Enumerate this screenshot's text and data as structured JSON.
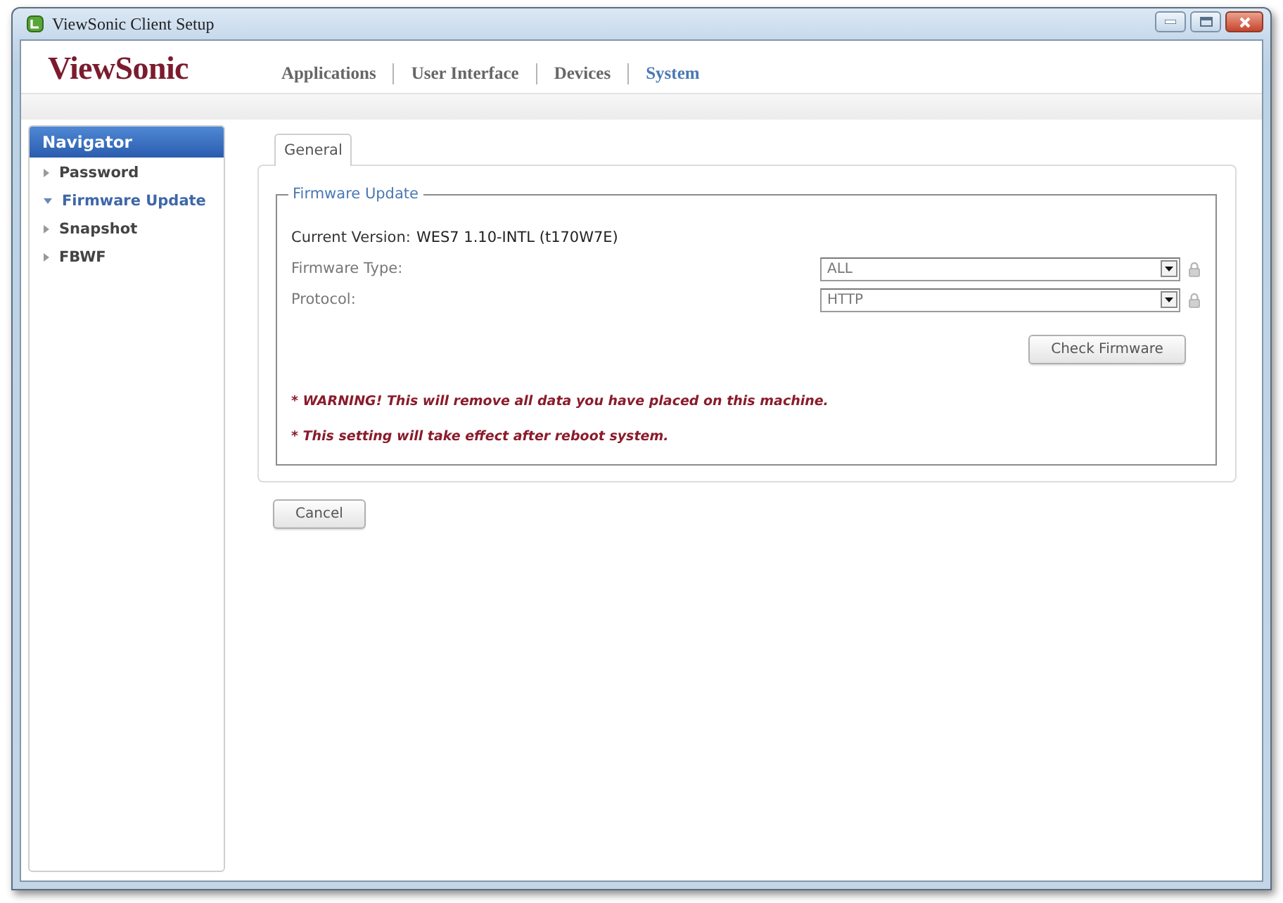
{
  "window": {
    "title": "ViewSonic Client Setup"
  },
  "header": {
    "logo": "ViewSonic",
    "nav": [
      {
        "label": "Applications",
        "selected": false
      },
      {
        "label": "User Interface",
        "selected": false
      },
      {
        "label": "Devices",
        "selected": false
      },
      {
        "label": "System",
        "selected": true
      }
    ]
  },
  "sidebar": {
    "title": "Navigator",
    "items": [
      {
        "label": "Password",
        "selected": false
      },
      {
        "label": "Firmware Update",
        "selected": true
      },
      {
        "label": "Snapshot",
        "selected": false
      },
      {
        "label": "FBWF",
        "selected": false
      }
    ]
  },
  "tabs": [
    {
      "label": "General",
      "selected": true
    }
  ],
  "firmware_update": {
    "legend": "Firmware Update",
    "current_version": {
      "label": "Current Version:",
      "value": "WES7 1.10-INTL (t170W7E)"
    },
    "fields": [
      {
        "label": "Firmware Type:",
        "value": "ALL",
        "locked": true
      },
      {
        "label": "Protocol:",
        "value": "HTTP",
        "locked": true
      }
    ],
    "button": "Check Firmware",
    "notes": [
      "* WARNING! This will remove all data you have placed on this machine.",
      "* This setting will take effect after reboot system."
    ]
  },
  "buttons": [
    "Cancel"
  ]
}
